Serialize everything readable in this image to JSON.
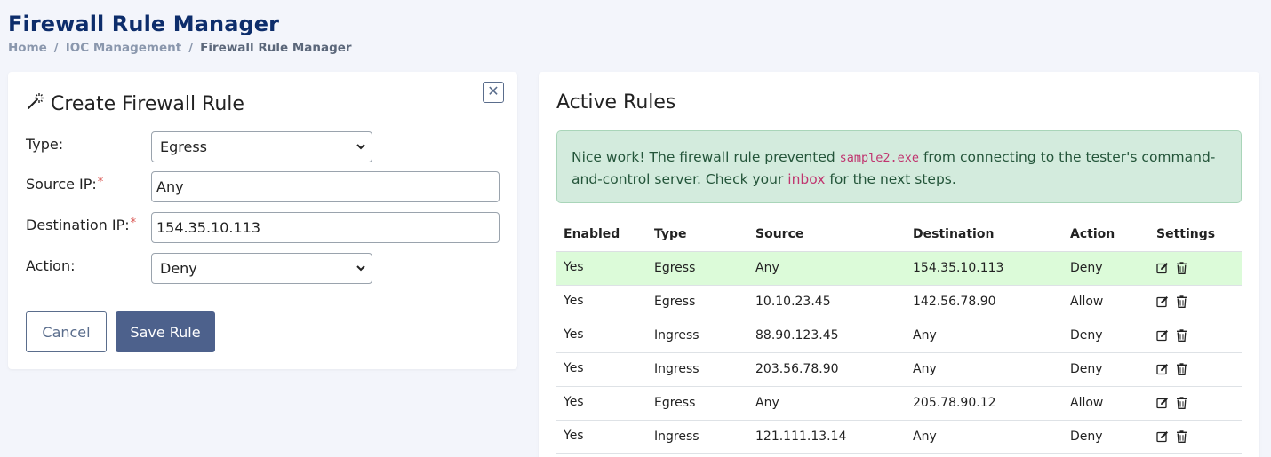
{
  "header": {
    "title": "Firewall Rule Manager",
    "breadcrumb": [
      "Home",
      "IOC Management",
      "Firewall Rule Manager"
    ],
    "breadcrumb_sep": "/"
  },
  "create_form": {
    "title": "Create Firewall Rule",
    "close_symbol": "✕",
    "type_label": "Type:",
    "type_value": "Egress",
    "source_label": "Source IP:",
    "source_value": "Any",
    "dest_label": "Destination IP:",
    "dest_value": "154.35.10.113",
    "action_label": "Action:",
    "action_value": "Deny",
    "required_mark": "*",
    "cancel_label": "Cancel",
    "save_label": "Save Rule"
  },
  "active_rules": {
    "title": "Active Rules",
    "alert": {
      "text_before": "Nice work! The firewall rule prevented ",
      "code": "sample2.exe",
      "text_middle": " from connecting to the tester's command-and-control server. Check your ",
      "link": "inbox",
      "text_after": " for the next steps."
    },
    "columns": [
      "Enabled",
      "Type",
      "Source",
      "Destination",
      "Action",
      "Settings"
    ],
    "rows": [
      {
        "enabled": "Yes",
        "type": "Egress",
        "source": "Any",
        "destination": "154.35.10.113",
        "action": "Deny"
      },
      {
        "enabled": "Yes",
        "type": "Egress",
        "source": "10.10.23.45",
        "destination": "142.56.78.90",
        "action": "Allow"
      },
      {
        "enabled": "Yes",
        "type": "Ingress",
        "source": "88.90.123.45",
        "destination": "Any",
        "action": "Deny"
      },
      {
        "enabled": "Yes",
        "type": "Ingress",
        "source": "203.56.78.90",
        "destination": "Any",
        "action": "Deny"
      },
      {
        "enabled": "Yes",
        "type": "Egress",
        "source": "Any",
        "destination": "205.78.90.12",
        "action": "Allow"
      },
      {
        "enabled": "Yes",
        "type": "Ingress",
        "source": "121.111.13.14",
        "destination": "Any",
        "action": "Deny"
      }
    ],
    "row_icons": [
      "edit-icon",
      "trash-icon"
    ],
    "highlight_color": "#dcfbd9"
  },
  "colors": {
    "title": "#0d2d6b",
    "primary_button": "#4d618c",
    "alert_bg": "#d3ebdd",
    "code_pink": "#c0356f"
  }
}
